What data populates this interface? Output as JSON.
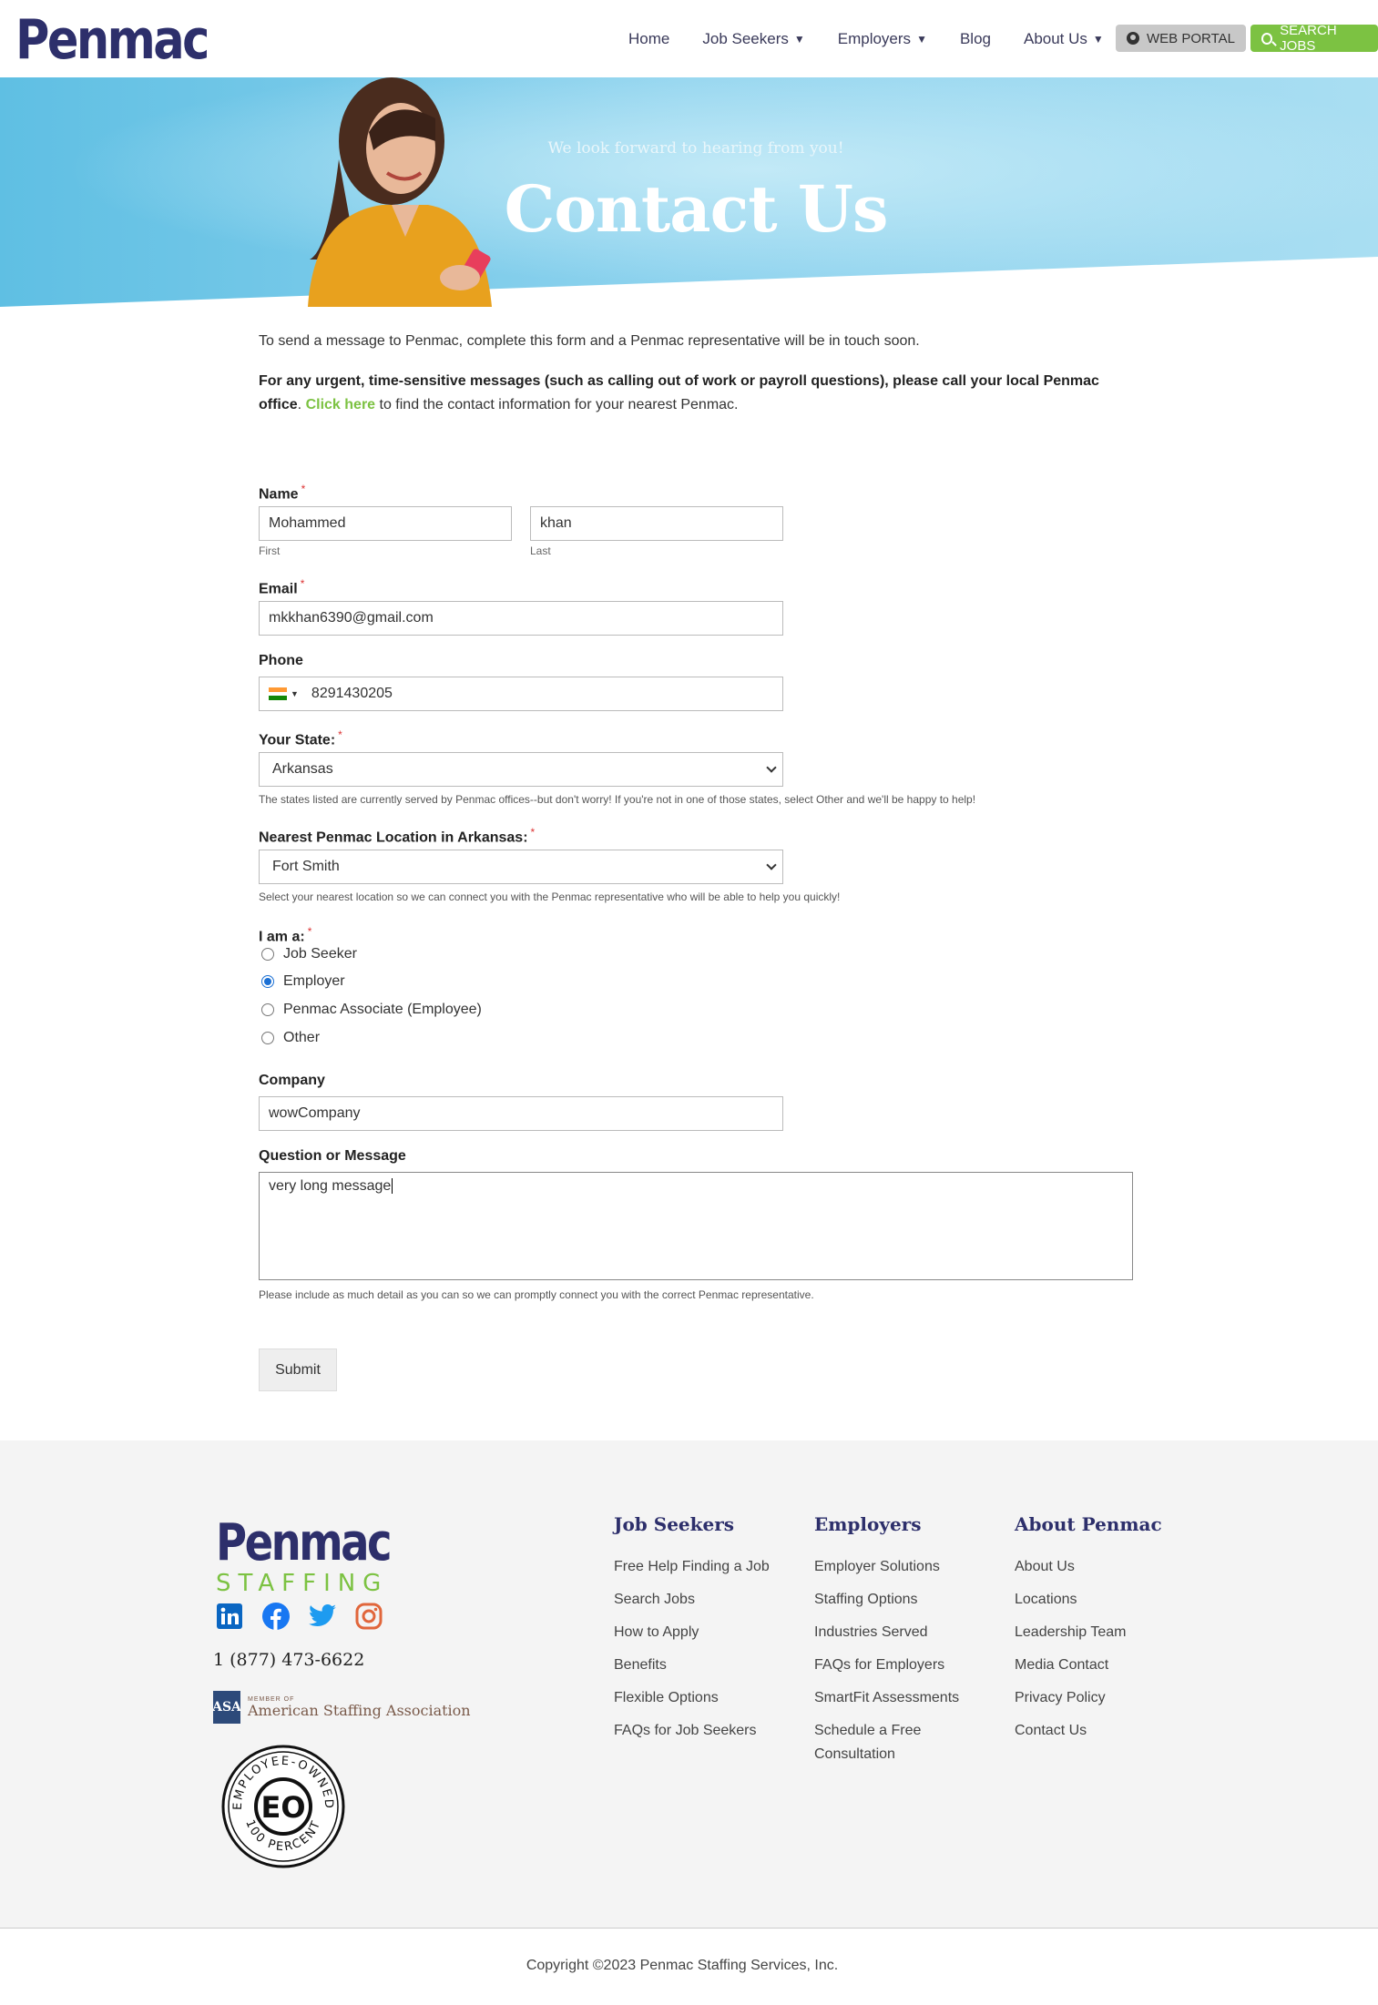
{
  "header": {
    "logo": "Penmac",
    "nav": [
      {
        "label": "Home",
        "dropdown": false
      },
      {
        "label": "Job Seekers",
        "dropdown": true
      },
      {
        "label": "Employers",
        "dropdown": true
      },
      {
        "label": "Blog",
        "dropdown": false
      },
      {
        "label": "About Us",
        "dropdown": true
      }
    ],
    "caret": "▼",
    "portal_label": "WEB PORTAL",
    "search_jobs_label": "SEARCH JOBS"
  },
  "hero": {
    "subtitle": "We look forward to hearing from you!",
    "title": "Contact Us"
  },
  "intro": {
    "line1": "To send a message to Penmac, complete this form and a Penmac representative will be in touch soon.",
    "urgent_bold": "For any urgent, time-sensitive messages (such as calling out of work or payroll questions), please call your local Penmac office",
    "urgent_period": ".",
    "click_here": "Click here",
    "urgent_tail": " to find the contact information for your nearest Penmac."
  },
  "form": {
    "required_mark": "*",
    "name": {
      "label": "Name",
      "first_value": "Mohammed",
      "last_value": "khan",
      "first_sub": "First",
      "last_sub": "Last"
    },
    "email": {
      "label": "Email",
      "value": "mkkhan6390@gmail.com"
    },
    "phone": {
      "label": "Phone",
      "value": "8291430205",
      "flag_colors": [
        "#ff9933",
        "#ffffff",
        "#138808"
      ],
      "flag_caret": "▼"
    },
    "state": {
      "label": "Your State:",
      "value": "Arkansas",
      "hint": "The states listed are currently served by Penmac offices--but don't worry! If you're not in one of those states, select Other and we'll be happy to help!"
    },
    "location": {
      "label": "Nearest Penmac Location in Arkansas:",
      "value": "Fort Smith",
      "hint": "Select your nearest location so we can connect you with the Penmac representative who will be able to help you quickly!"
    },
    "iam": {
      "label": "I am a:",
      "options": [
        {
          "label": "Job Seeker",
          "checked": false
        },
        {
          "label": "Employer",
          "checked": true
        },
        {
          "label": "Penmac Associate (Employee)",
          "checked": false
        },
        {
          "label": "Other",
          "checked": false
        }
      ]
    },
    "company": {
      "label": "Company",
      "value": "wowCompany"
    },
    "message": {
      "label": "Question or Message",
      "value": "very long message",
      "hint": "Please include as much detail as you can so we can promptly connect you with the correct Penmac representative."
    },
    "submit_label": "Submit"
  },
  "footer": {
    "logo_big": "Penmac",
    "logo_staffing": "STAFFING",
    "social": [
      "linkedin-icon",
      "facebook-icon",
      "twitter-icon",
      "instagram-icon"
    ],
    "phone": "1 (877) 473-6622",
    "asa_abbr": "ASA",
    "asa_member": "MEMBER OF",
    "asa_name": "American Staffing Association",
    "eo_badge": {
      "center": "EO",
      "top": "EMPLOYEE-OWNED",
      "bottom": "100 PERCENT"
    },
    "columns": [
      {
        "title": "Job Seekers",
        "links": [
          "Free Help Finding a Job",
          "Search Jobs",
          "How to Apply",
          "Benefits",
          "Flexible Options",
          "FAQs for Job Seekers"
        ]
      },
      {
        "title": "Employers",
        "links": [
          "Employer Solutions",
          "Staffing Options",
          "Industries Served",
          "FAQs for Employers",
          "SmartFit Assessments",
          "Schedule a Free Consultation"
        ]
      },
      {
        "title": "About Penmac",
        "links": [
          "About Us",
          "Locations",
          "Leadership Team",
          "Media Contact",
          "Privacy Policy",
          "Contact Us"
        ]
      }
    ],
    "copyright": "Copyright ©2023 Penmac Staffing Services, Inc."
  },
  "colors": {
    "brand_navy": "#2d2f6b",
    "brand_green": "#7cc242",
    "hero_blue": "#8dd0ea"
  }
}
